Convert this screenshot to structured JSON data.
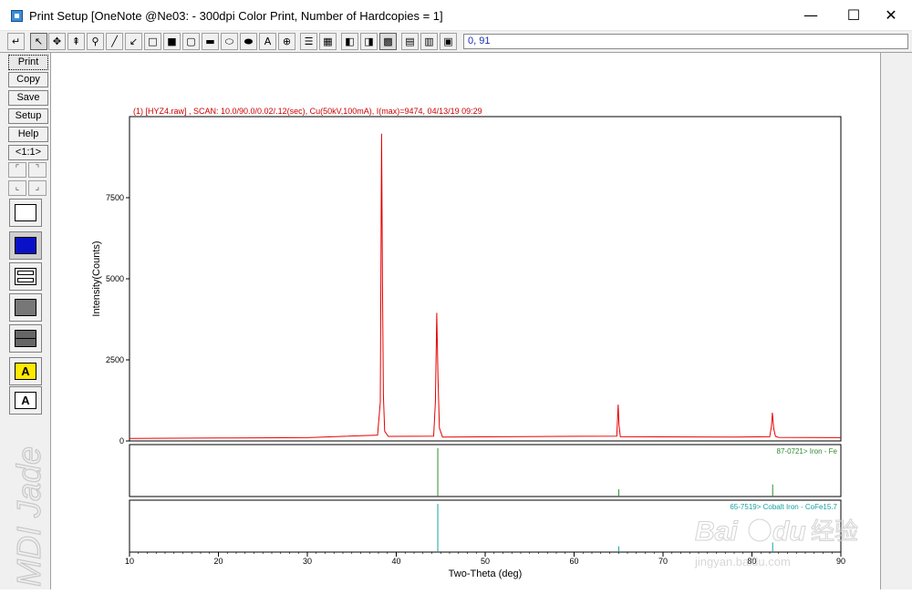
{
  "window": {
    "title": "Print Setup [OneNote @Ne03: - 300dpi Color Print, Number of Hardcopies = 1]",
    "minimize_glyph": "—",
    "maximize_glyph": "☐",
    "close_glyph": "✕"
  },
  "toolbar": {
    "coordinates": "0, 91",
    "tools": [
      "back-arrow-icon",
      "pointer-icon",
      "move-icon",
      "text-cursor-icon",
      "zoom-icon",
      "line-icon",
      "arrow-icon",
      "rectangle-icon",
      "filled-rectangle-icon",
      "rounded-rectangle-icon",
      "filled-rounded-rectangle-icon",
      "ellipse-icon",
      "filled-ellipse-icon",
      "text-A-icon",
      "symbol-icon",
      "list-icon",
      "grid-icon",
      "half-fill-icon",
      "gradient-icon",
      "palette-icon",
      "pattern-icon",
      "table-icon",
      "page-icon"
    ]
  },
  "sidebar": {
    "buttons": [
      {
        "label": "Print"
      },
      {
        "label": "Copy"
      },
      {
        "label": "Save"
      },
      {
        "label": "Setup"
      },
      {
        "label": "Help"
      },
      {
        "label": "<1:1>"
      }
    ],
    "brand_text": "MDI Jade"
  },
  "colors": {
    "pattern": "#e60000",
    "ref1": "#2e8b2e",
    "ref2": "#1aa0a0",
    "header": "#cc0000"
  },
  "chart_data": {
    "type": "line",
    "header": "(1) [HYZ4.raw] , SCAN: 10.0/90.0/0.02/.12(sec), Cu(50kV,100mA), I(max)=9474, 04/13/19 09:29",
    "xlabel": "Two-Theta (deg)",
    "ylabel": "Intensity(Counts)",
    "xlim": [
      10,
      90
    ],
    "ylim": [
      0,
      10000
    ],
    "xticks": [
      "10",
      "20",
      "30",
      "40",
      "50",
      "60",
      "70",
      "80",
      "90"
    ],
    "yticks": [
      "0",
      "2500",
      "5000",
      "7500"
    ],
    "series": [
      {
        "x": [
          10,
          20,
          30,
          37.9,
          38.2,
          38.35,
          38.45,
          38.55,
          38.7,
          39.1,
          44.2,
          44.4,
          44.55,
          44.7,
          44.85,
          45.2,
          64.8,
          64.95,
          65.05,
          65.2,
          78.0,
          82.0,
          82.2,
          82.3,
          82.45,
          82.65,
          83.0,
          90
        ],
        "y": [
          80,
          90,
          100,
          180,
          1200,
          9474,
          4800,
          1400,
          300,
          140,
          150,
          1200,
          3950,
          1900,
          400,
          120,
          150,
          1120,
          500,
          130,
          120,
          130,
          480,
          870,
          380,
          140,
          110,
          100
        ]
      }
    ],
    "references": [
      {
        "label": "87-0721> Iron - Fe",
        "positions": [
          44.67,
          65.02,
          82.33
        ],
        "intensities": [
          100,
          15,
          25
        ]
      },
      {
        "label": "65-7519> Cobalt Iron - CoFe15.7",
        "positions": [
          44.67,
          65.02,
          82.33
        ],
        "intensities": [
          100,
          12,
          20
        ]
      }
    ]
  },
  "watermark": {
    "brand": "Bai",
    "brand2": "du",
    "cn": "经验",
    "url": "jingyan.baidu.com"
  }
}
